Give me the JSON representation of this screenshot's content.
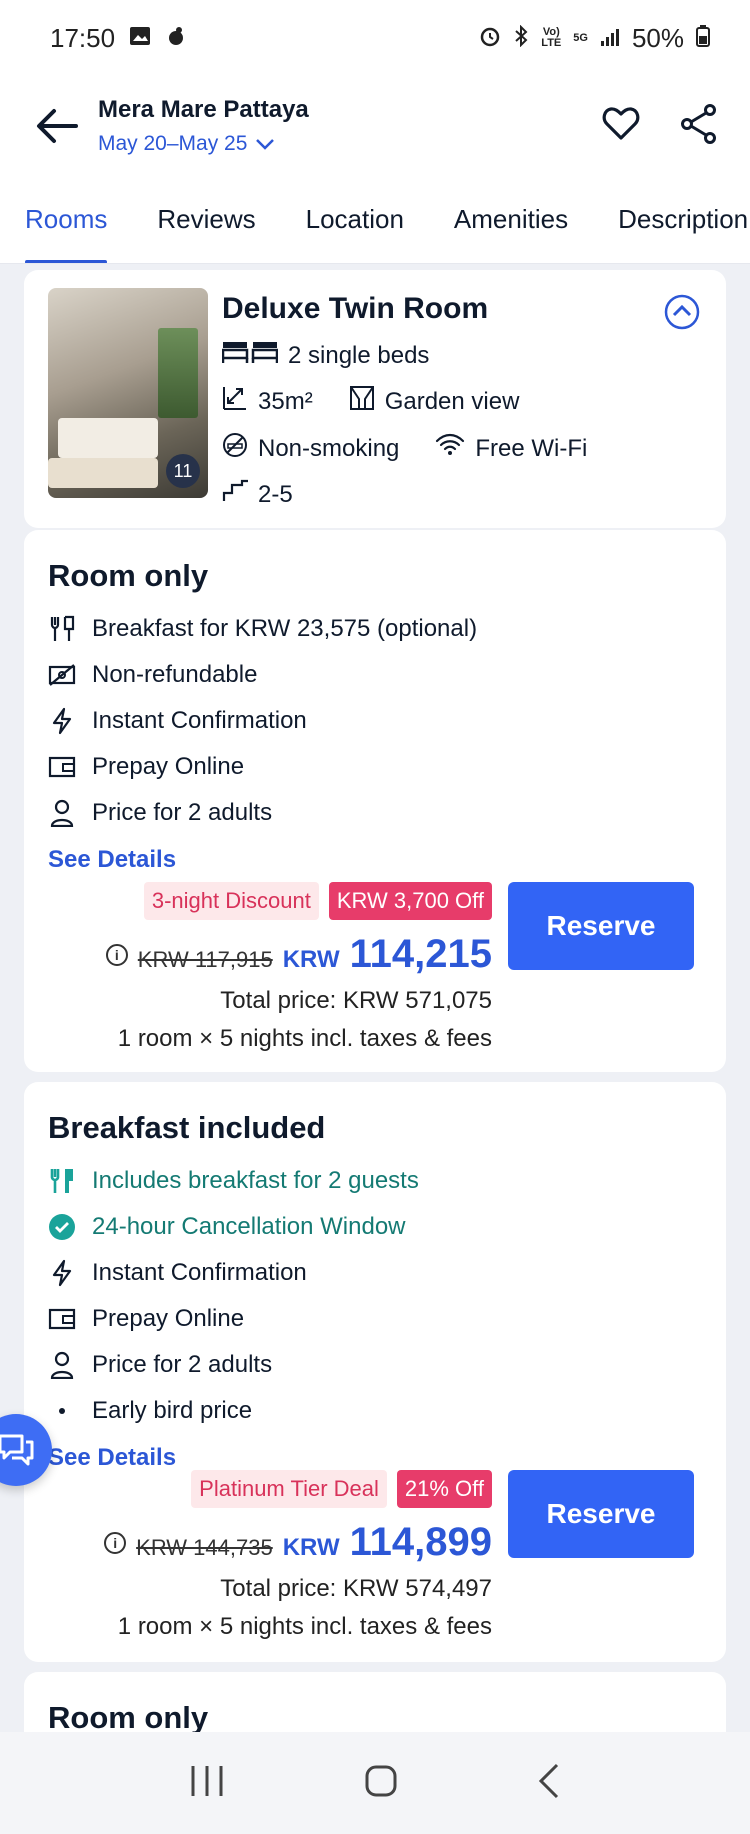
{
  "status_bar": {
    "time": "17:50",
    "battery": "50%",
    "network": "5G"
  },
  "header": {
    "hotel_name": "Mera Mare Pattaya",
    "dates": "May 20–May 25"
  },
  "tabs": [
    {
      "label": "Rooms",
      "active": true
    },
    {
      "label": "Reviews",
      "active": false
    },
    {
      "label": "Location",
      "active": false
    },
    {
      "label": "Amenities",
      "active": false
    },
    {
      "label": "Description",
      "active": false
    }
  ],
  "room": {
    "title": "Deluxe Twin Room",
    "beds": "2 single beds",
    "size": "35m²",
    "view": "Garden view",
    "smoking": "Non-smoking",
    "wifi": "Free Wi-Fi",
    "floors": "2-5",
    "photo_count": "11"
  },
  "rates": [
    {
      "title": "Room only",
      "features": [
        {
          "icon": "utensils-icon",
          "text": "Breakfast for KRW 23,575 (optional)",
          "green": false
        },
        {
          "icon": "no-refund-icon",
          "text": "Non-refundable",
          "green": false
        },
        {
          "icon": "lightning-icon",
          "text": "Instant Confirmation",
          "green": false
        },
        {
          "icon": "wallet-icon",
          "text": "Prepay Online",
          "green": false
        },
        {
          "icon": "person-icon",
          "text": "Price for 2 adults",
          "green": false
        }
      ],
      "see_details": "See Details",
      "badge_soft": "3-night Discount",
      "badge_hot": "KRW 3,700 Off",
      "old_price": "KRW 117,915",
      "currency": "KRW",
      "price": "114,215",
      "total": "Total price: KRW 571,075",
      "nights": "1 room × 5 nights incl. taxes & fees",
      "reserve": "Reserve"
    },
    {
      "title": "Breakfast included",
      "features": [
        {
          "icon": "utensils-icon",
          "text": "Includes breakfast for 2 guests",
          "green": true
        },
        {
          "icon": "check-circle-icon",
          "text": "24-hour Cancellation Window",
          "green": true
        },
        {
          "icon": "lightning-icon",
          "text": "Instant Confirmation",
          "green": false
        },
        {
          "icon": "wallet-icon",
          "text": "Prepay Online",
          "green": false
        },
        {
          "icon": "person-icon",
          "text": "Price for 2 adults",
          "green": false
        },
        {
          "icon": "bullet-icon",
          "text": "Early bird price",
          "green": false
        }
      ],
      "see_details": "See Details",
      "badge_soft": "Platinum Tier Deal",
      "badge_hot": "21% Off",
      "old_price": "KRW 144,735",
      "currency": "KRW",
      "price": "114,899",
      "total": "Total price: KRW 574,497",
      "nights": "1 room × 5 nights incl. taxes & fees",
      "reserve": "Reserve"
    },
    {
      "title": "Room only"
    }
  ]
}
